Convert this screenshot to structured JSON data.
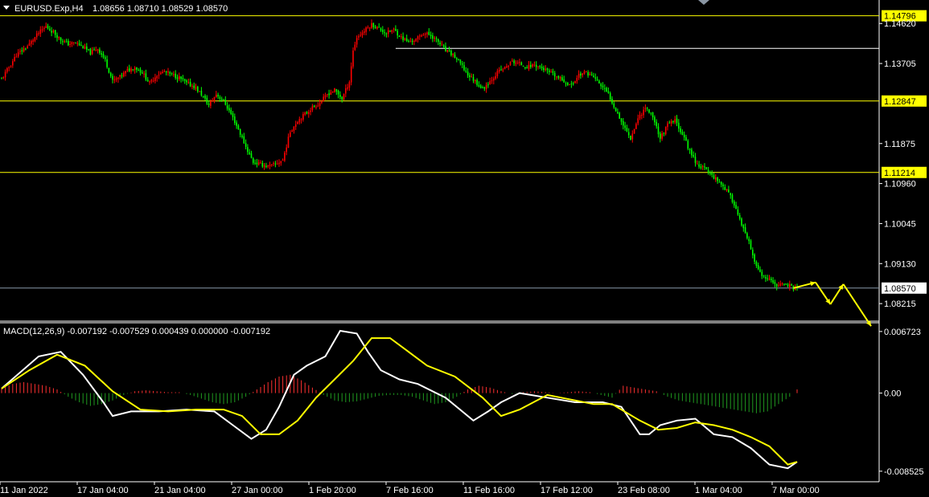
{
  "header": {
    "symbol_label": "EURUSD.Exp,H4",
    "ohlc": "1.08656 1.08710 1.08529 1.08570"
  },
  "macd_header": "MACD(12,26,9) -0.007192 -0.007529 0.000439 0.000000 -0.007192",
  "colors": {
    "background": "#000000",
    "bull": "#ff0000",
    "bear": "#00ff00",
    "level": "#ffff00",
    "grid": "#ffffff",
    "macd_main": "#ffffff",
    "macd_signal": "#ffff00",
    "hist_pos": "#ff3030",
    "hist_neg": "#1f9a1f"
  },
  "chart_data": [
    {
      "type": "candlestick",
      "title": "EURUSD.Exp,H4",
      "ylim": [
        1.0785,
        1.1512
      ],
      "price_ticks": [
        "1.14620",
        "1.13705",
        "1.11875",
        "1.10960",
        "1.10045",
        "1.09130",
        "1.08215"
      ],
      "time_ticks": [
        "11 Jan 2022",
        "17 Jan 04:00",
        "21 Jan 04:00",
        "27 Jan 00:00",
        "1 Feb 20:00",
        "7 Feb 16:00",
        "11 Feb 16:00",
        "17 Feb 12:00",
        "23 Feb 08:00",
        "1 Mar 04:00",
        "7 Mar 00:00"
      ],
      "horizontal_levels": [
        {
          "price": 1.14796,
          "label": "1.14796",
          "color": "#ffff00"
        },
        {
          "price": 1.12847,
          "label": "1.12847",
          "color": "#ffff00"
        },
        {
          "price": 1.11214,
          "label": "1.11214",
          "color": "#ffff00"
        },
        {
          "price": 1.1405,
          "label": "",
          "color": "#ffffff"
        },
        {
          "price": 1.0857,
          "label": "1.08570",
          "color": "#8899aa"
        }
      ],
      "close_path": [
        [
          0,
          1.1335
        ],
        [
          8,
          1.139
        ],
        [
          14,
          1.141
        ],
        [
          20,
          1.144
        ],
        [
          24,
          1.1455
        ],
        [
          28,
          1.1442
        ],
        [
          32,
          1.1425
        ],
        [
          36,
          1.1415
        ],
        [
          40,
          1.1418
        ],
        [
          44,
          1.1408
        ],
        [
          48,
          1.1395
        ],
        [
          52,
          1.1405
        ],
        [
          56,
          1.1378
        ],
        [
          60,
          1.133
        ],
        [
          64,
          1.134
        ],
        [
          68,
          1.1355
        ],
        [
          72,
          1.1362
        ],
        [
          76,
          1.135
        ],
        [
          80,
          1.1325
        ],
        [
          84,
          1.1345
        ],
        [
          88,
          1.1352
        ],
        [
          92,
          1.1345
        ],
        [
          96,
          1.1338
        ],
        [
          100,
          1.1325
        ],
        [
          104,
          1.1318
        ],
        [
          108,
          1.13
        ],
        [
          112,
          1.1275
        ],
        [
          116,
          1.13
        ],
        [
          120,
          1.1285
        ],
        [
          124,
          1.1255
        ],
        [
          128,
          1.122
        ],
        [
          132,
          1.118
        ],
        [
          136,
          1.1145
        ],
        [
          140,
          1.114
        ],
        [
          144,
          1.1135
        ],
        [
          148,
          1.114
        ],
        [
          152,
          1.115
        ],
        [
          156,
          1.1215
        ],
        [
          160,
          1.124
        ],
        [
          164,
          1.1255
        ],
        [
          168,
          1.127
        ],
        [
          172,
          1.128
        ],
        [
          176,
          1.13
        ],
        [
          180,
          1.131
        ],
        [
          184,
          1.129
        ],
        [
          188,
          1.133
        ],
        [
          190,
          1.14
        ],
        [
          192,
          1.143
        ],
        [
          196,
          1.1445
        ],
        [
          200,
          1.146
        ],
        [
          204,
          1.145
        ],
        [
          208,
          1.144
        ],
        [
          212,
          1.1448
        ],
        [
          216,
          1.143
        ],
        [
          220,
          1.142
        ],
        [
          224,
          1.1425
        ],
        [
          228,
          1.144
        ],
        [
          232,
          1.1435
        ],
        [
          236,
          1.142
        ],
        [
          240,
          1.14
        ],
        [
          244,
          1.139
        ],
        [
          248,
          1.137
        ],
        [
          252,
          1.1345
        ],
        [
          256,
          1.133
        ],
        [
          260,
          1.1312
        ],
        [
          264,
          1.133
        ],
        [
          268,
          1.135
        ],
        [
          272,
          1.136
        ],
        [
          276,
          1.1375
        ],
        [
          280,
          1.137
        ],
        [
          284,
          1.1362
        ],
        [
          288,
          1.1368
        ],
        [
          292,
          1.136
        ],
        [
          296,
          1.135
        ],
        [
          300,
          1.134
        ],
        [
          304,
          1.133
        ],
        [
          308,
          1.132
        ],
        [
          312,
          1.1345
        ],
        [
          316,
          1.135
        ],
        [
          320,
          1.134
        ],
        [
          324,
          1.132
        ],
        [
          328,
          1.13
        ],
        [
          332,
          1.1265
        ],
        [
          336,
          1.123
        ],
        [
          340,
          1.12
        ],
        [
          344,
          1.1245
        ],
        [
          348,
          1.127
        ],
        [
          352,
          1.125
        ],
        [
          356,
          1.12
        ],
        [
          360,
          1.123
        ],
        [
          364,
          1.124
        ],
        [
          368,
          1.121
        ],
        [
          372,
          1.117
        ],
        [
          376,
          1.114
        ],
        [
          380,
          1.113
        ],
        [
          384,
          1.1115
        ],
        [
          388,
          1.11
        ],
        [
          392,
          1.108
        ],
        [
          396,
          1.105
        ],
        [
          400,
          1.1
        ],
        [
          404,
          1.096
        ],
        [
          408,
          1.0905
        ],
        [
          412,
          1.088
        ],
        [
          416,
          1.0872
        ],
        [
          420,
          1.0862
        ],
        [
          424,
          1.0868
        ],
        [
          428,
          1.0857
        ]
      ],
      "projection": [
        {
          "x": 428,
          "price": 1.0857
        },
        {
          "x": 440,
          "price": 1.087
        },
        {
          "x": 448,
          "price": 1.082
        },
        {
          "x": 455,
          "price": 1.0866
        },
        {
          "x": 470,
          "price": 1.077
        }
      ]
    },
    {
      "type": "line",
      "title": "MACD(12,26,9)",
      "ylim": [
        -0.0095,
        0.0075
      ],
      "y_ticks": [
        "0.006723",
        "0.00",
        "-0.008525"
      ],
      "series": [
        {
          "name": "MACD(12,26,9)",
          "x": [
            0,
            20,
            32,
            44,
            55,
            60,
            70,
            85,
            100,
            115,
            125,
            135,
            143,
            150,
            158,
            165,
            175,
            183,
            192,
            198,
            205,
            215,
            225,
            240,
            255,
            263,
            270,
            280,
            295,
            310,
            325,
            335,
            345,
            350,
            356,
            365,
            375,
            385,
            395,
            405,
            415,
            425,
            430
          ],
          "y": [
            0.0005,
            0.004,
            0.0045,
            0.002,
            -0.001,
            -0.0025,
            -0.002,
            -0.002,
            -0.0018,
            -0.002,
            -0.0035,
            -0.005,
            -0.004,
            -0.0015,
            0.002,
            0.003,
            0.004,
            0.0068,
            0.0065,
            0.0045,
            0.0025,
            0.0015,
            0.001,
            -0.0005,
            -0.003,
            -0.002,
            -0.001,
            0.0,
            -0.0005,
            -0.001,
            -0.001,
            -0.0015,
            -0.0045,
            -0.0045,
            -0.0035,
            -0.003,
            -0.0028,
            -0.0045,
            -0.0048,
            -0.006,
            -0.0078,
            -0.0082,
            -0.0075
          ]
        },
        {
          "name": "",
          "x": [
            0,
            15,
            30,
            45,
            60,
            75,
            90,
            105,
            120,
            130,
            140,
            150,
            160,
            170,
            180,
            190,
            200,
            210,
            220,
            230,
            245,
            260,
            270,
            280,
            295,
            310,
            320,
            330,
            345,
            355,
            365,
            375,
            385,
            395,
            405,
            415,
            425,
            430
          ],
          "y": [
            0.0005,
            0.0025,
            0.0042,
            0.003,
            0.0002,
            -0.0018,
            -0.002,
            -0.0018,
            -0.0018,
            -0.0025,
            -0.0045,
            -0.0045,
            -0.003,
            -0.0005,
            0.0015,
            0.0035,
            0.006,
            0.006,
            0.0045,
            0.003,
            0.0018,
            -0.0005,
            -0.0025,
            -0.0018,
            -0.0002,
            -0.0008,
            -0.0012,
            -0.0012,
            -0.003,
            -0.004,
            -0.0038,
            -0.0032,
            -0.0035,
            -0.004,
            -0.0048,
            -0.0058,
            -0.0078,
            -0.0075
          ]
        }
      ],
      "histogram_x": [
        0,
        6,
        12,
        18,
        24,
        30,
        36,
        42,
        48,
        54,
        60,
        66,
        72,
        78,
        84,
        90,
        96,
        102,
        108,
        114,
        120,
        126,
        132,
        138,
        144,
        150,
        156,
        162,
        168,
        174,
        180,
        186,
        192,
        198,
        204,
        210,
        216,
        222,
        228,
        234,
        240,
        246,
        252,
        258,
        264,
        270,
        276,
        282,
        288,
        294,
        300,
        306,
        312,
        318,
        324,
        330,
        336,
        342,
        348,
        354,
        360,
        366,
        372,
        378,
        384,
        390,
        396,
        402,
        408,
        414,
        420,
        426,
        430
      ],
      "histogram": [
        0.0005,
        0.001,
        0.0012,
        0.001,
        0.0008,
        0.0004,
        -0.0004,
        -0.001,
        -0.0014,
        -0.0012,
        -0.0008,
        -0.0002,
        0.0002,
        0.0003,
        0.0002,
        0.0001,
        0.0001,
        -0.0002,
        -0.0006,
        -0.001,
        -0.0012,
        -0.001,
        -0.0004,
        0.0004,
        0.0012,
        0.0018,
        0.002,
        0.0014,
        0.0006,
        -0.0002,
        -0.0008,
        -0.001,
        -0.0009,
        -0.0006,
        -0.0003,
        -0.0002,
        -0.0002,
        -0.0004,
        -0.0008,
        -0.0012,
        -0.001,
        -0.0004,
        0.0004,
        0.0008,
        0.0006,
        0.0002,
        -0.0001,
        0.0001,
        0.0002,
        0.0001,
        0.0,
        0.0001,
        0.0002,
        0.0001,
        -0.0002,
        -0.0005,
        0.0008,
        0.0006,
        0.0004,
        0.0002,
        -0.0004,
        -0.0008,
        -0.001,
        -0.0012,
        -0.0014,
        -0.0016,
        -0.0018,
        -0.002,
        -0.0022,
        -0.002,
        -0.0012,
        -0.0004,
        0.0004
      ]
    }
  ]
}
